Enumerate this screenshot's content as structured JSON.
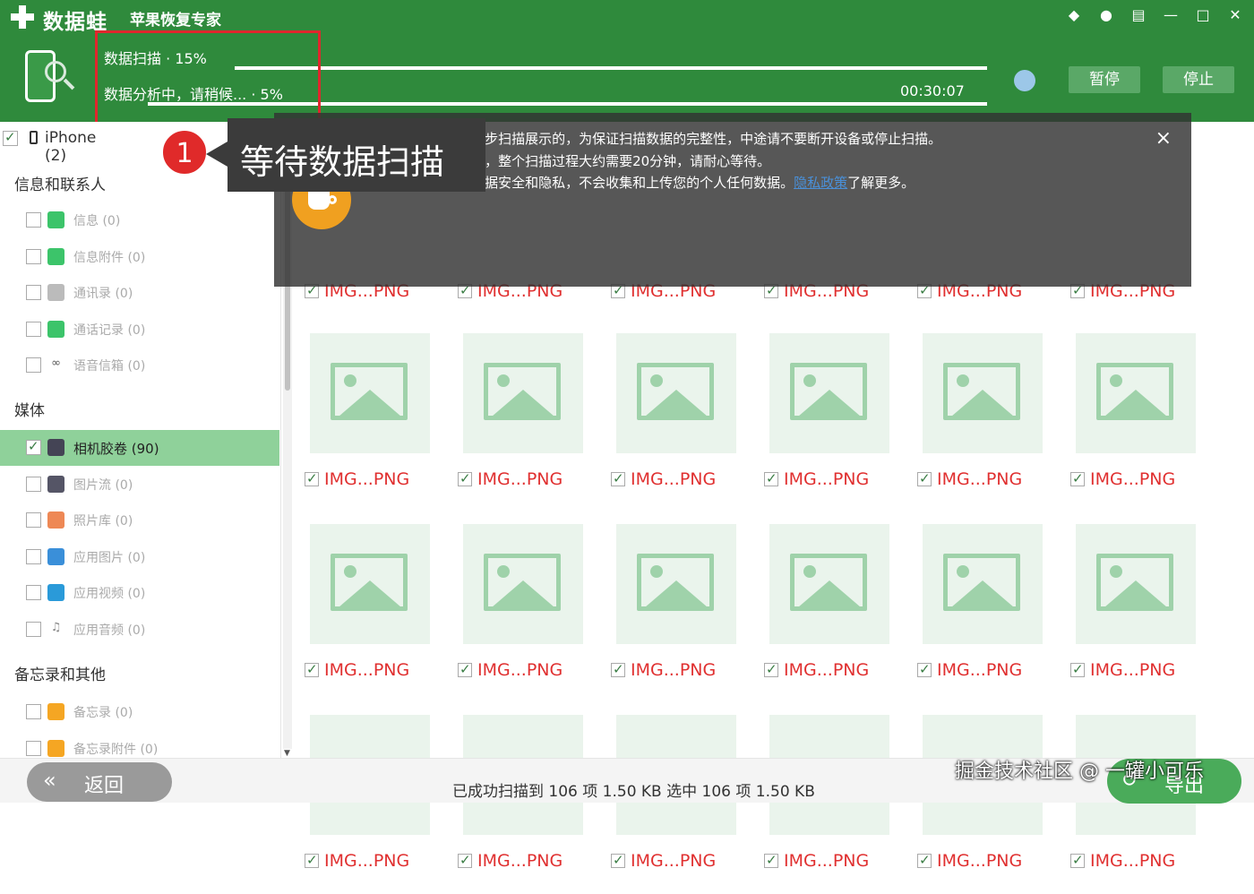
{
  "app": {
    "name": "数据蛙",
    "subtitle": "苹果恢复专家"
  },
  "scan": {
    "label1": "数据扫描 · 15%",
    "progress1": 0.15,
    "label2": "数据分析中，请稍候... · 5%",
    "progress2": 0.05,
    "elapsed": "00:30:07",
    "pause_label": "暂停",
    "stop_label": "停止"
  },
  "sidebar": {
    "device": "iPhone (2)",
    "groups": [
      {
        "title": "信息和联系人",
        "items": [
          "信息 (0)",
          "信息附件 (0)",
          "通讯录 (0)",
          "通话记录 (0)",
          "语音信箱 (0)"
        ]
      },
      {
        "title": "媒体",
        "items": [
          "相机胶卷 (90)",
          "图片流 (0)",
          "照片库 (0)",
          "应用图片 (0)",
          "应用视频 (0)",
          "应用音频 (0)"
        ]
      },
      {
        "title": "备忘录和其他",
        "items": [
          "备忘录 (0)",
          "备忘录附件 (0)"
        ]
      }
    ]
  },
  "grid": {
    "caption": "IMG...PNG"
  },
  "tip": {
    "line1": "1. 扫描出的数据是逐步扫描展示的，为保证扫描数据的完整性，中途请不要断开设备或停止扫描。",
    "line2": "2. 根据设备的数据量，整个扫描过程大约需要20分钟，请耐心等待。",
    "line3a": "3. 我们将保护您的数据安全和隐私，不会收集和上传您的个人任何数据。",
    "line3_link": "隐私政策",
    "line3b": "了解更多。",
    "close": "×"
  },
  "annotation": {
    "number": "1",
    "text": "等待数据扫描"
  },
  "footer": {
    "back": "返回",
    "status": "已成功扫描到 106 项 1.50 KB  选中 106 项 1.50 KB",
    "export": "导出"
  },
  "watermark": "掘金技术社区 @ 一罐小可乐",
  "colors": {
    "brand_green": "#2f8a3c",
    "selected_row": "#8fd19a",
    "caption_red": "#e03030",
    "highlight_red": "#e0272d"
  }
}
